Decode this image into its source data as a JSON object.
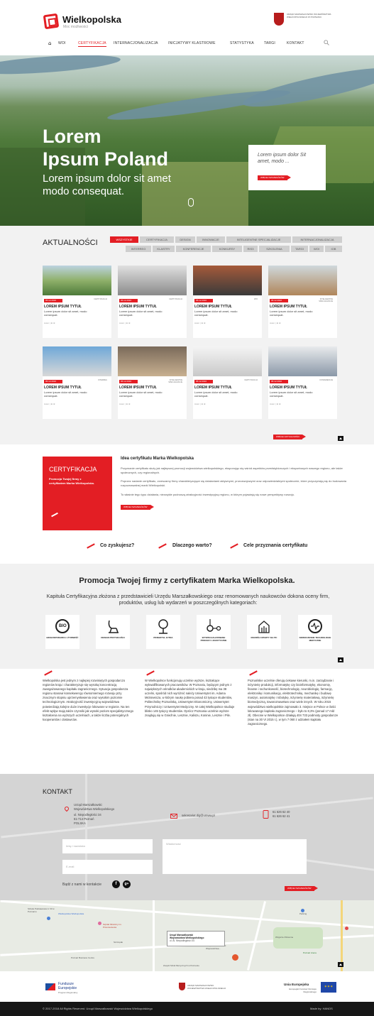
{
  "header": {
    "brand": "Wielkopolska",
    "brand_sub": "Moc możliwości",
    "crest_text": "Urząd Marszałkowski Województwa Wielkopolskiego w Poznaniu",
    "nav": [
      "WOI",
      "CERTYFIKACJA",
      "INTERNACJONALIZACJA",
      "INICJATYWY KLASTROWE",
      "STATYSTYKA",
      "TARGI",
      "KONTAKT"
    ],
    "active_nav": "CERTYFIKACJA"
  },
  "hero": {
    "title_line1": "Lorem",
    "title_line2": "Ipsum Poland",
    "sub_line1": "Lorem ipsum dolor sit amet",
    "sub_line2": "modo consequat.",
    "card_text": "Lorem ipsum dolor Sit amet, modo ...",
    "card_button": "więcej szczegółów"
  },
  "news": {
    "title": "AKTUALNOŚCI",
    "filters_row1": [
      "WSZYSTKIE",
      "CERTYFIKACJA",
      "DESIGN",
      "INNOWACJE",
      "INTELIGENTNE SPECJALIZACJE",
      "INTERNACJONALIZACJA"
    ],
    "filters_row2": [
      "INTERREG",
      "KLASTRY",
      "KONFERENCJE",
      "KONKURSY",
      "RIS3",
      "SZKOLENIA",
      "TARGI",
      "WOI",
      "IOB"
    ],
    "cards": [
      {
        "date": "05.12.2016",
        "cat": "CERTYFIKACJA",
        "title": "LOREM IPSUM TYTUŁ",
        "body": "Lorem ipsum dolor sit amet, modo consequat.",
        "meta": "Autor | ⊕ ⊕"
      },
      {
        "date": "05.12.2016",
        "cat": "CERTYFIKACJA",
        "title": "LOREM IPSUM TYTUŁ",
        "body": "Lorem ipsum dolor sit amet, modo consequat.",
        "meta": "Autor | ⊕ ⊕"
      },
      {
        "date": "05.12.2016",
        "cat": "WOI",
        "title": "LOREM IPSUM TYTUŁ",
        "body": "Lorem ipsum dolor sit amet, modo consequat.",
        "meta": "Autor | ⊕ ⊕"
      },
      {
        "date": "05.12.2016",
        "cat": "INTELIGENTNE SPECJALIZACJE",
        "title": "LOREM IPSUM TYTUŁ",
        "body": "Lorem ipsum dolor sit amet, modo consequat.",
        "meta": "Autor | ⊕ ⊕"
      },
      {
        "date": "05.12.2016",
        "cat": "INTERREG",
        "title": "LOREM IPSUM TYTUŁ",
        "body": "Lorem ipsum dolor sit amet, modo consequat.",
        "meta": "Autor | ⊕ ⊕"
      },
      {
        "date": "05.12.2016",
        "cat": "INTELIGENTNE SPECJALIZACJE",
        "title": "LOREM IPSUM TYTUŁ",
        "body": "Lorem ipsum dolor sit amet, modo consequat.",
        "meta": "Autor | ⊕ ⊕"
      },
      {
        "date": "05.12.2016",
        "cat": "CERTYFIKACJA",
        "title": "LOREM IPSUM TYTUŁ",
        "body": "Lorem ipsum dolor sit amet, modo consequat.",
        "meta": "Autor | ⊕ ⊕"
      },
      {
        "date": "05.12.2016",
        "cat": "KONFERENCJE",
        "title": "LOREM IPSUM TYTUŁ",
        "body": "Lorem ipsum dolor sit amet, modo consequat.",
        "meta": "Autor | ⊕ ⊕"
      }
    ],
    "more_button": "więcej aktualności"
  },
  "cert": {
    "box_title": "CERTYFIKACJA",
    "box_text": "Promocja Twojej firmy z certyfikatem Marka Wielkopolska.",
    "idea_title": "Idea certyfikatu Marka Wielkopolska",
    "p1": "Przyznanie certyfikatu służy jak najlepszej promocji województwa wielkopolskiego, eksponując się wśród aspektów przedsiębiorczych i eksportowych naszego regionu, ale także społecznych, czy regionalnych.",
    "p2": "Poprzez nadanie certyfikatu, zrzeszamy firmy charakteryzujące się działaniami aktywnymi, prorozwojowymi oraz odpowiedzialnymi społecznie, które przyczyniają się do budowania rozpoznawalnej marki Wielkopolski.",
    "p3": "To właśnie tego typu działania, niezwykle podnoszą atrakcyjność inwestycyjną regionu, w którym pojawiają się nowe perspektywy rozwoju.",
    "button": "więcej szczegółów",
    "q1": "Co zyskujesz?",
    "q2": "Dlaczego warto?",
    "q3": "Cele przyznania certyfikatu"
  },
  "promo": {
    "title": "Promocja Twojej firmy z certyfikatem Marka Wielkopolska.",
    "text": "Kapituła Certyfikacyjna złożona z przedstawicieli Urzędu Marszałkowskiego oraz renomowanych naukowców dokona oceny firm, produktów, usług lub wydarzeń w poszczególnych kategoriach:",
    "tiles": [
      "BIOGOSPODARKA I ŻYWNOŚĆ",
      "DESIGN PRZYSZŁOŚCI",
      "PRZEMYSŁ JUTRA",
      "WYSPECJALIZOWANE PROCESY LOGISTYCZNE",
      "ROZWÓJ OPARTY NA ITC",
      "NOWOCZESNE TECHNOLOGIE MEDYCZNE"
    ],
    "bio_label": "BIO"
  },
  "info": {
    "col1": "Wielkopolska jest jednym z najlepiej rozwiniętych gospodarczo regionów kraju i charakteryzuje się wysoką koncentracją zaangażowanego kapitału zagranicznego. Sytuacja gospodarcza regionu stanowi konsekwencję równomiernego rozwoju przy znacznym stopniu uprzemysłowienia oraz wysokim poziomie technologicznym. Atrakcyjność inwestycyjną województwa potwierdzają kolejne duże inwestycje lokowane w regionie. Na ten efekt wpływ mają także czynniki jak wysoki poziom specjalistycznego kształcenia na wyższych uczelniach, a także liczba potencjalnych kooperantów i dostawców.",
    "col2": "W Wielkopolsce funkcjonują uczelnie wyższe, kształcące wykwalifikowanych pracowników. W Poznaniu, będącym jednym z największych ośrodków akademickich w kraju, siedzibę ma 38 uczelni, spośród nich wyróżnić należy Uniwersytet im. Adama Mickiewicza, w którym naukę pobiera ponad 43 tysiące studentów, Politechnikę Poznańską, Uniwersytet Ekonomiczny, Uniwersytet Przyrodniczy i Uniwersytet Medyczny. W całej Wielkopolsce studiuje blisko 145 tysięcy studentów. Oprócz Poznania uczelnie wyższe znajdują się w Gnieźnie, Lesznie, Kaliszu, Koninie, Lesznie i Pile.",
    "col3": "Poznańskie uczelnie oferują ciekawe kierunki, m.in. zarządzanie i inżynierię produkcji, informatykę czy bioinformatykę, ekonomię, finanse i rachunkowość, biotechnologię, neurobiologię, farmację, elektronikę i komunikację, elektrotechnikę, mechanikę i budowę maszyn, automatykę i robotykę, inżynierię materiałową, inżynierię biomedyczną, towaroznawstwo oraz wiele innych. W roku 2015 województwo wielkopolskie zajmowało 3. miejsce w Polsce w ilości lokowanego kapitału zagranicznego – było to 8,3% (ponad 17 mld zł). Obecnie w Wielkopolsce działają 404 733 podmioty gospodarcze (stan na 30 VI 2015 r.), w tym 7 060 z udziałem kapitału zagranicznego."
  },
  "contact": {
    "title": "KONTAKT",
    "office1": "Urząd Marszałkowski",
    "office2": "Województwa Wielkopolskiego",
    "street": "ul. Niepodległości 34",
    "city": "61-714 Poznań",
    "country": "POLSKA",
    "email": "sekretariat.dig@umww.pl",
    "phone1": "61 626 62 40",
    "phone2": "61 626 62 41",
    "name_placeholder": "Imię i nazwisko",
    "email_placeholder": "E-mail",
    "message_placeholder": "Wiadomość",
    "social_text": "Bądź z nami w kontakcie",
    "send_button": "więcej szczegółów"
  },
  "map": {
    "labels": [
      "Szkoła Podstawowa nr 33 w Poznaniu",
      "Wielkopolska Wielkopolska",
      "Urząd Marszałkowski Województwa Wielkopolskiego",
      "ul. Al. Niepodległości 34",
      "Szpital Kliniczny im. Przemienienia",
      "Szczupak",
      "Urząd Marszałkowski Województwa...",
      "Zespół Szkół Muzycznych w Poznaniu",
      "Poznań Business Centre",
      "Parking",
      "Wzgórze Północne",
      "Poznań Arena"
    ],
    "callout_line1": "Urząd Marszałkowski",
    "callout_line2": "Województwa Wielkopolskiego",
    "callout_line3": "ul. Al. Niepodległości 34"
  },
  "sponsors": {
    "fundusze1": "Fundusze",
    "fundusze2": "Europejskie",
    "fundusze3": "Program Regionalny",
    "crest_text": "Urząd Marszałkowski Województwa Wielkopolskiego",
    "ue1": "Unia Europejska",
    "ue2": "Europejski Fundusz Rozwoju Regionalnego"
  },
  "footer": {
    "copyright": "© 2017-2018 All Rights Reserved. Urząd Marszałkowski Województwa Wielkopolskiego",
    "made_by": "Made by: HANOS"
  },
  "colors": {
    "accent": "#e31e24",
    "footer": "#161616",
    "news_bg": "#f2f2f2"
  }
}
